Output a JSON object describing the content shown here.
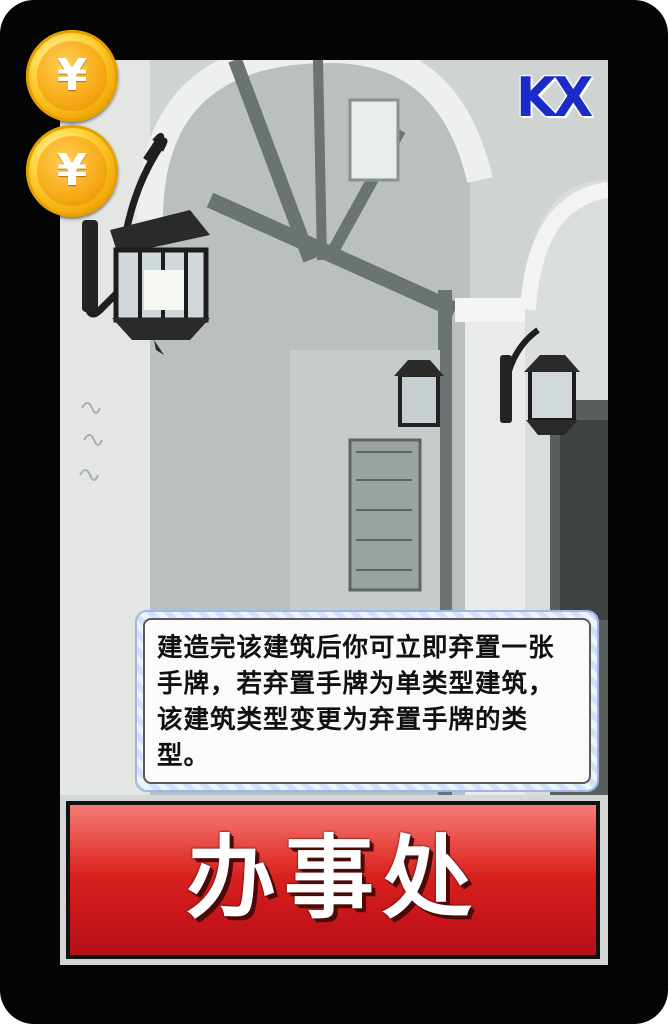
{
  "card": {
    "name": "办事处",
    "set_code": "KX",
    "ability_text": "建造完该建筑后你可立即弃置一张手牌，若弃置手牌为单类型建筑，该建筑类型变更为弃置手牌的类型。",
    "cost": {
      "coin_count": 2,
      "coin_symbols": [
        "¥",
        "¥"
      ]
    },
    "artwork": "wall-lanterns-arched-building-photo",
    "colors": {
      "name_plate": "#d81e1e",
      "set_code": "#1a2bc8",
      "coin": "#f7a915",
      "frame": "#050505"
    }
  }
}
